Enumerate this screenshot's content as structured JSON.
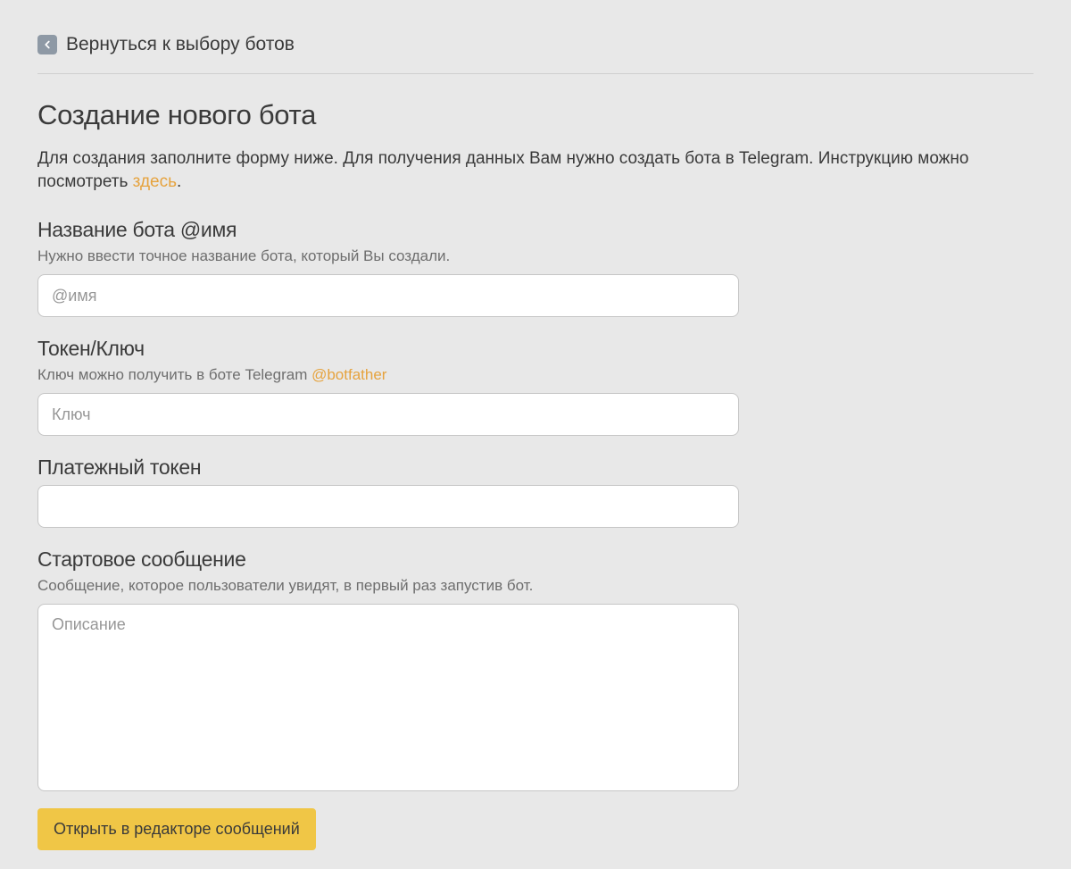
{
  "back": {
    "label": "Вернуться к выбору ботов"
  },
  "page": {
    "title": "Создание нового бота",
    "intro_part1": "Для создания заполните форму ниже. Для получения данных Вам нужно создать бота в Telegram. Инструкцию можно посмотреть ",
    "intro_link": "здесь",
    "intro_part2": "."
  },
  "fields": {
    "botname": {
      "label": "Название бота @имя",
      "help": "Нужно ввести точное название бота, который Вы создали.",
      "placeholder": "@имя",
      "value": ""
    },
    "token": {
      "label": "Токен/Ключ",
      "help_text": "Ключ можно получить в боте Telegram ",
      "help_link": "@botfather",
      "placeholder": "Ключ",
      "value": ""
    },
    "payment_token": {
      "label": "Платежный токен",
      "placeholder": "",
      "value": ""
    },
    "start_message": {
      "label": "Стартовое сообщение",
      "help": "Сообщение, которое пользователи увидят, в первый раз запустив бот.",
      "placeholder": "Описание",
      "value": ""
    }
  },
  "buttons": {
    "open_editor": "Открыть в редакторе сообщений"
  }
}
